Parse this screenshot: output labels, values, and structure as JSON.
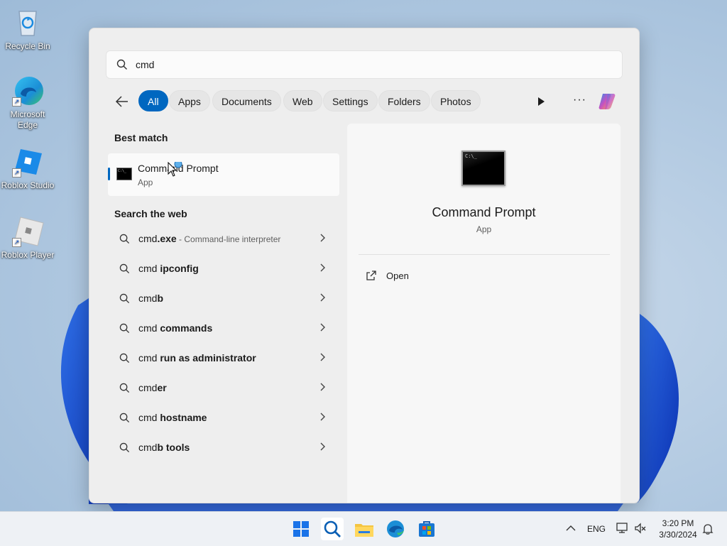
{
  "desktop": {
    "icons": [
      {
        "label": "Recycle Bin",
        "icon": "recycle-bin-icon"
      },
      {
        "label": "Microsoft Edge",
        "icon": "edge-icon"
      },
      {
        "label": "Roblox Studio",
        "icon": "roblox-studio-icon"
      },
      {
        "label": "Roblox Player",
        "icon": "roblox-player-icon"
      }
    ]
  },
  "search": {
    "query": "cmd"
  },
  "filters": [
    "All",
    "Apps",
    "Documents",
    "Web",
    "Settings",
    "Folders",
    "Photos"
  ],
  "best_match": {
    "heading": "Best match",
    "name": "Command Prompt",
    "type": "App"
  },
  "web": {
    "heading": "Search the web",
    "results": [
      {
        "prefix": "cmd",
        "bold": ".exe",
        "desc": " - Command-line interpreter"
      },
      {
        "prefix": "cmd ",
        "bold": "ipconfig",
        "desc": ""
      },
      {
        "prefix": "cmd",
        "bold": "b",
        "desc": ""
      },
      {
        "prefix": "cmd ",
        "bold": "commands",
        "desc": ""
      },
      {
        "prefix": "cmd ",
        "bold": "run as administrator",
        "desc": ""
      },
      {
        "prefix": "cmd",
        "bold": "er",
        "desc": ""
      },
      {
        "prefix": "cmd ",
        "bold": "hostname",
        "desc": ""
      },
      {
        "prefix": "cmd",
        "bold": "b tools",
        "desc": ""
      }
    ]
  },
  "detail": {
    "name": "Command Prompt",
    "type": "App",
    "actions": [
      {
        "label": "Open",
        "icon": "open-external-icon"
      }
    ]
  },
  "taskbar": {
    "apps": [
      "start-icon",
      "search-icon",
      "file-explorer-icon",
      "edge-icon",
      "store-icon"
    ],
    "language": "ENG",
    "time": "3:20 PM",
    "date": "3/30/2024"
  },
  "colors": {
    "accent": "#0067c0",
    "panel": "#eeeeee"
  }
}
